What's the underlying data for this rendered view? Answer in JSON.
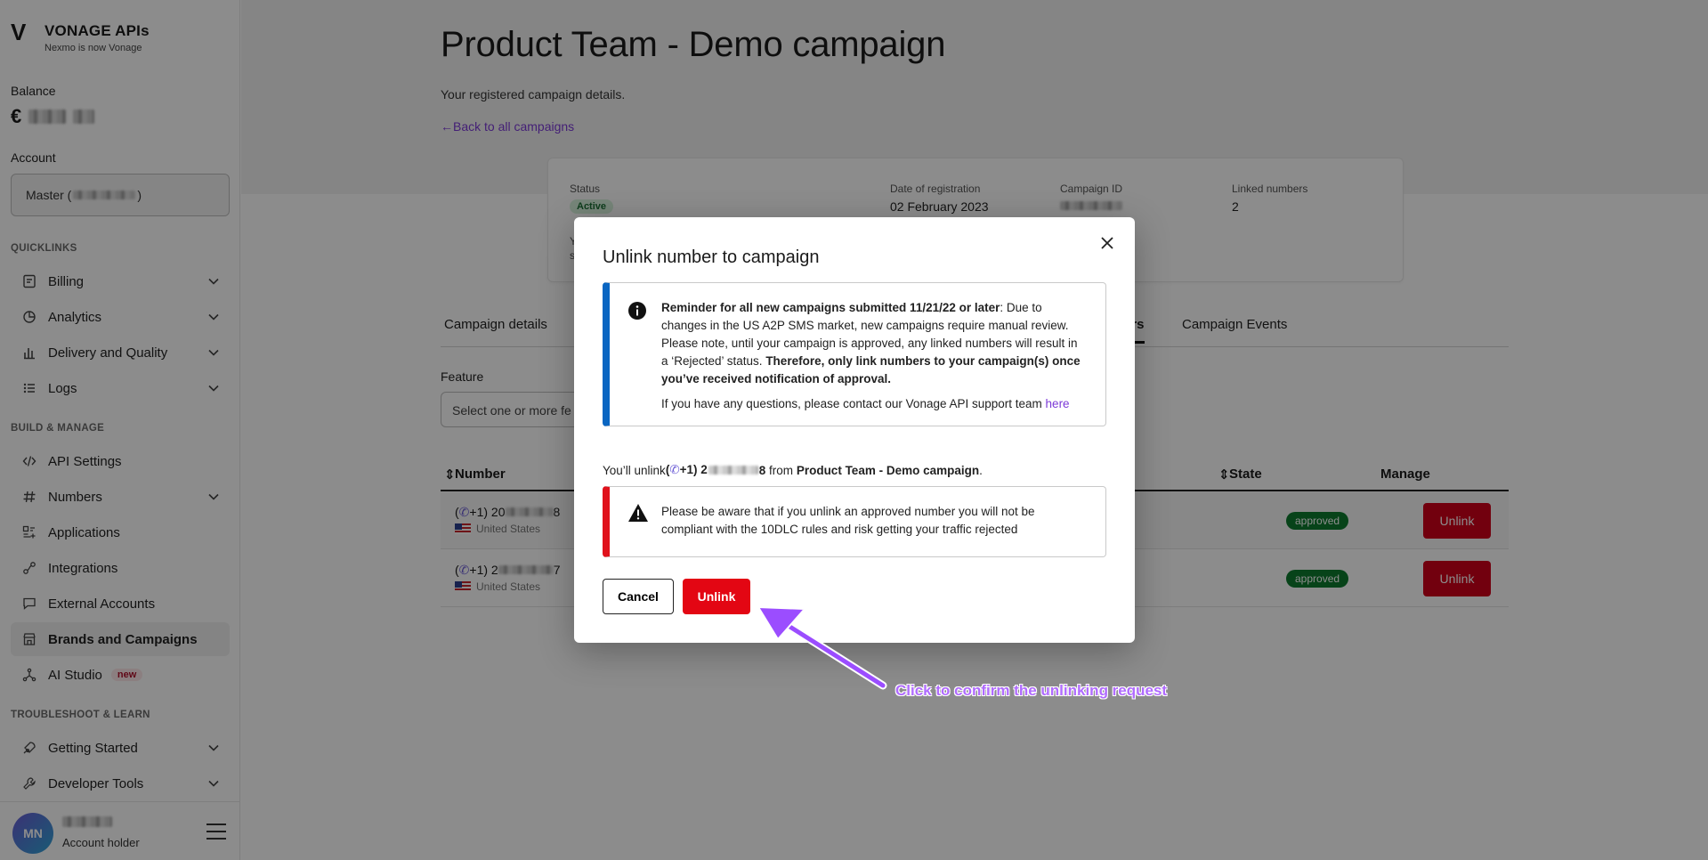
{
  "brand": {
    "name": "VONAGE APIs",
    "tagline": "Nexmo is now Vonage"
  },
  "sidebar": {
    "balance_label": "Balance",
    "currency": "€",
    "account_label": "Account",
    "account_value": "Master (",
    "account_value_end": ")",
    "sections": {
      "quicklinks": "QUICKLINKS",
      "build": "BUILD & MANAGE",
      "troubleshoot": "TROUBLESHOOT & LEARN"
    },
    "quicklinks": [
      {
        "label": "Billing",
        "icon": "billing-icon"
      },
      {
        "label": "Analytics",
        "icon": "analytics-icon"
      },
      {
        "label": "Delivery and Quality",
        "icon": "chart-icon"
      },
      {
        "label": "Logs",
        "icon": "list-icon"
      }
    ],
    "build": [
      {
        "label": "API Settings",
        "icon": "code-icon"
      },
      {
        "label": "Numbers",
        "icon": "hash-icon"
      },
      {
        "label": "Applications",
        "icon": "applications-icon"
      },
      {
        "label": "Integrations",
        "icon": "integrations-icon"
      },
      {
        "label": "External Accounts",
        "icon": "chat-icon"
      },
      {
        "label": "Brands and Campaigns",
        "icon": "store-icon"
      },
      {
        "label": "AI Studio",
        "icon": "ai-icon",
        "badge": "new"
      }
    ],
    "troubleshoot": [
      {
        "label": "Getting Started",
        "icon": "rocket-icon"
      },
      {
        "label": "Developer Tools",
        "icon": "tools-icon"
      }
    ],
    "user": {
      "initials": "MN",
      "role": "Account holder"
    }
  },
  "main": {
    "title": "Product Team - Demo campaign",
    "subtitle": "Your registered campaign details.",
    "back_link": "←Back to all campaigns",
    "card": {
      "status_label": "Status",
      "status_value": "Active",
      "date_label": "Date of registration",
      "date_value": "02 February 2023",
      "campaign_id_label": "Campaign ID",
      "linked_label": "Linked numbers",
      "linked_value": "2",
      "snippet_a": "Y",
      "snippet_b": "s"
    },
    "tabs": {
      "details": "Campaign details",
      "numbers": "ers",
      "events": "Campaign Events"
    },
    "feature_label": "Feature",
    "feature_placeholder": "Select one or more fe",
    "table": {
      "col_number": "Number",
      "col_state": "State",
      "col_manage": "Manage",
      "rows": [
        {
          "num_prefix": "(",
          "num_a": "+1) 20",
          "num_b": "8",
          "country": "United States",
          "state": "approved",
          "action": "Unlink"
        },
        {
          "num_prefix": "(",
          "num_a": "+1) 2",
          "num_b": "7",
          "country": "United States",
          "state": "approved",
          "action": "Unlink"
        }
      ]
    }
  },
  "modal": {
    "title": "Unlink number to campaign",
    "info_bold": "Reminder for all new campaigns submitted 11/21/22 or later",
    "info_text": ": Due to changes in the US A2P SMS market, new campaigns require manual review. Please note, until your campaign is approved, any linked numbers will result in a ‘Rejected’ status. ",
    "info_bold2": "Therefore, only link numbers to your campaign(s) once you’ve received notification of approval.",
    "info_contact": "If you have any questions, please contact our Vonage API support team",
    "info_link": "here",
    "unlink_pre": "You’ll unlink ",
    "unlink_num_pre": "(",
    "unlink_num_a": "+1) 2",
    "unlink_num_b": "8",
    "unlink_mid": " from ",
    "unlink_campaign": "Product Team - Demo campaign",
    "unlink_post": ".",
    "warn_text": "Please be aware that if you unlink an approved number you will not be compliant with the 10DLC rules and risk getting your traffic rejected",
    "cancel": "Cancel",
    "unlink": "Unlink"
  },
  "annotation": {
    "text": "Click to confirm the unlinking request",
    "color": "#b06bff"
  },
  "colors": {
    "accent": "#7c3ad7",
    "danger": "#e30613",
    "info": "#0a66c2",
    "success": "#0d7a2f"
  }
}
